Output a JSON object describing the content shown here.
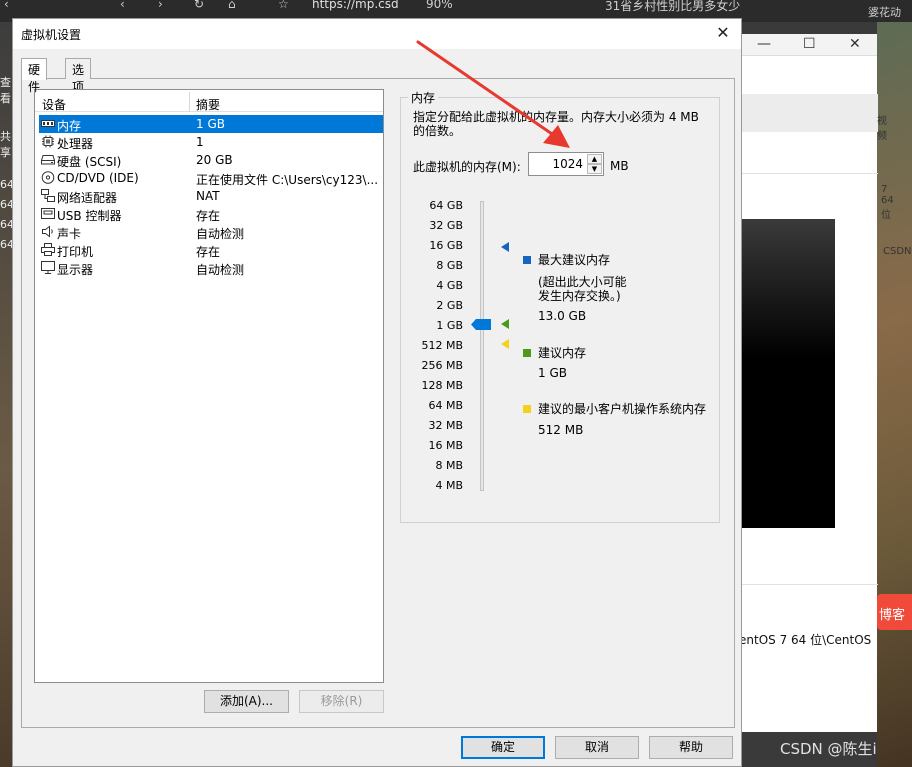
{
  "background": {
    "browser_url": "https://mp.csd",
    "browser_zoom": "90%",
    "browser_tab_text": "31省乡村性别比男多女少",
    "browser_right_text": "婆花动",
    "right_window": {
      "toolbar_label": "视频",
      "note_text": "7 64 位",
      "os_text": "entOS 7 64 位\\CentOS",
      "watermark_top": "CSDN"
    },
    "left_text": [
      "查看",
      "共享",
      "64",
      "64",
      "64",
      "64"
    ],
    "csdn_button": "博客",
    "watermark": "CSDN @陈生i"
  },
  "dialog": {
    "title": "虚拟机设置",
    "tabs": [
      {
        "label": "硬件",
        "active": true
      },
      {
        "label": "选项",
        "active": false
      }
    ],
    "device_list": {
      "col_device": "设备",
      "col_summary": "摘要",
      "rows": [
        {
          "name": "内存",
          "summary": "1 GB",
          "icon": "memory-icon",
          "selected": true
        },
        {
          "name": "处理器",
          "summary": "1",
          "icon": "processor-icon",
          "selected": false
        },
        {
          "name": "硬盘 (SCSI)",
          "summary": "20 GB",
          "icon": "hard-disk-icon",
          "selected": false
        },
        {
          "name": "CD/DVD (IDE)",
          "summary": "正在使用文件 C:\\Users\\cy123\\...",
          "icon": "cd-dvd-icon",
          "selected": false
        },
        {
          "name": "网络适配器",
          "summary": "NAT",
          "icon": "network-adapter-icon",
          "selected": false
        },
        {
          "name": "USB 控制器",
          "summary": "存在",
          "icon": "usb-controller-icon",
          "selected": false
        },
        {
          "name": "声卡",
          "summary": "自动检测",
          "icon": "sound-card-icon",
          "selected": false
        },
        {
          "name": "打印机",
          "summary": "存在",
          "icon": "printer-icon",
          "selected": false
        },
        {
          "name": "显示器",
          "summary": "自动检测",
          "icon": "display-icon",
          "selected": false
        }
      ]
    },
    "add_button": "添加(A)...",
    "remove_button": "移除(R)",
    "memory": {
      "group_title": "内存",
      "description": "指定分配给此虚拟机的内存量。内存大小必须为 4 MB 的倍数。",
      "memory_label": "此虚拟机的内存(M):",
      "memory_value": "1024",
      "memory_unit": "MB",
      "scale_ticks": [
        "64 GB",
        "32 GB",
        "16 GB",
        "8 GB",
        "4 GB",
        "2 GB",
        "1 GB",
        "512 MB",
        "256 MB",
        "128 MB",
        "64 MB",
        "32 MB",
        "16 MB",
        "8 MB",
        "4 MB"
      ],
      "legend": {
        "max": {
          "title": "最大建议内存",
          "note1": "(超出此大小可能",
          "note2": "发生内存交换。)",
          "value": "13.0 GB",
          "color": "#1565c0"
        },
        "recommended": {
          "title": "建议内存",
          "value": "1 GB",
          "color": "#4c9a1a"
        },
        "min": {
          "title": "建议的最小客户机操作系统内存",
          "value": "512 MB",
          "color": "#f2d21b"
        }
      }
    },
    "buttons": {
      "ok": "确定",
      "cancel": "取消",
      "help": "帮助"
    }
  },
  "colors": {
    "selection": "#0078d7",
    "annotation_arrow": "#e8392f",
    "thumb": "#0078d7"
  }
}
